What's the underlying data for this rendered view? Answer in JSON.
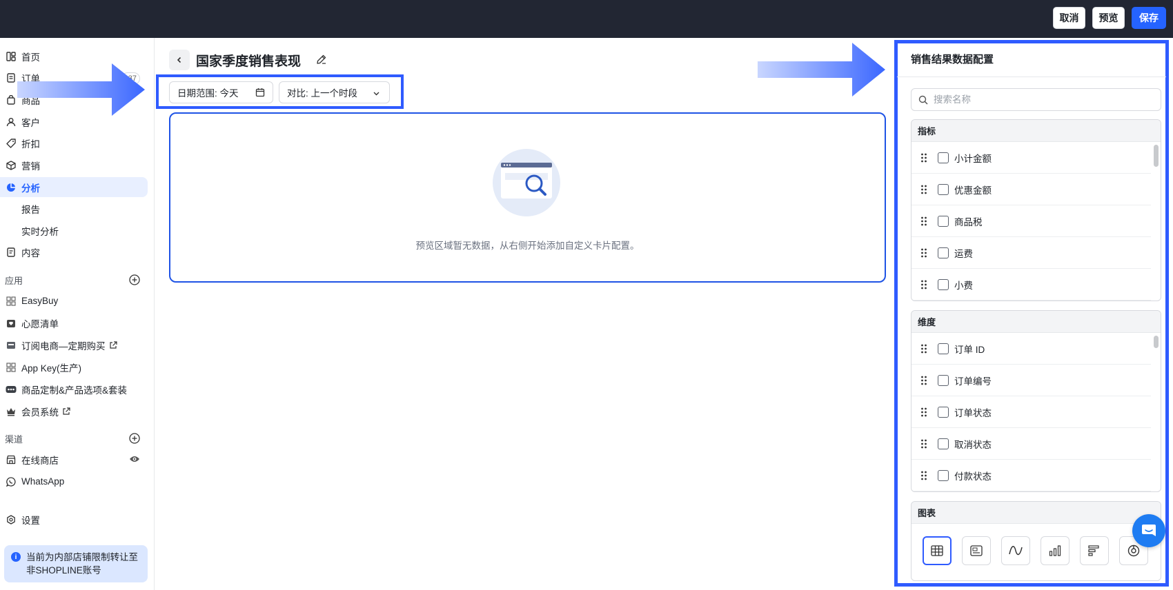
{
  "topbar": {
    "cancel_label": "取消",
    "preview_label": "预览",
    "save_label": "保存"
  },
  "sidebar": {
    "items": [
      {
        "label": "首页",
        "icon": "dashboard-icon"
      },
      {
        "label": "订单",
        "icon": "order-icon",
        "badge": "37"
      },
      {
        "label": "商品",
        "icon": "bag-icon"
      },
      {
        "label": "客户",
        "icon": "person-icon"
      },
      {
        "label": "折扣",
        "icon": "tag-icon"
      },
      {
        "label": "营销",
        "icon": "cube-icon"
      },
      {
        "label": "分析",
        "icon": "pie-chart-icon"
      },
      {
        "label": "报告"
      },
      {
        "label": "实时分析"
      },
      {
        "label": "内容",
        "icon": "document-icon"
      }
    ],
    "apps_title": "应用",
    "apps": [
      {
        "label": "EasyBuy"
      },
      {
        "label": "心愿清单"
      },
      {
        "label": "订阅电商—定期购买"
      },
      {
        "label": "App Key(生产)"
      },
      {
        "label": "商品定制&产品选项&套装"
      },
      {
        "label": "会员系统"
      }
    ],
    "channels_title": "渠道",
    "channels": [
      {
        "label": "在线商店"
      },
      {
        "label": "WhatsApp"
      }
    ],
    "settings_label": "设置",
    "notice": "当前为内部店铺限制转让至非SHOPLINE账号"
  },
  "main": {
    "title": "国家季度销售表现",
    "date_filter": "日期范围: 今天",
    "compare_filter": "对比: 上一个时段",
    "empty_text": "预览区域暂无数据，从右侧开始添加自定义卡片配置。"
  },
  "panel": {
    "title": "销售结果数据配置",
    "search_placeholder": "搜索名称",
    "metrics_title": "指标",
    "metrics": [
      "小计金额",
      "优惠金额",
      "商品税",
      "运费",
      "小费"
    ],
    "dimensions_title": "维度",
    "dimensions": [
      "订单 ID",
      "订单编号",
      "订单状态",
      "取消状态",
      "付款状态"
    ],
    "charts_title": "图表",
    "chart_types": [
      "table-icon",
      "number-card-icon",
      "line-chart-icon",
      "bar-chart-icon",
      "horizontal-bar-icon",
      "donut-chart-icon"
    ]
  },
  "colors": {
    "accent": "#2563ff",
    "topbar": "#222633",
    "highlight_border": "#2f5bff"
  }
}
